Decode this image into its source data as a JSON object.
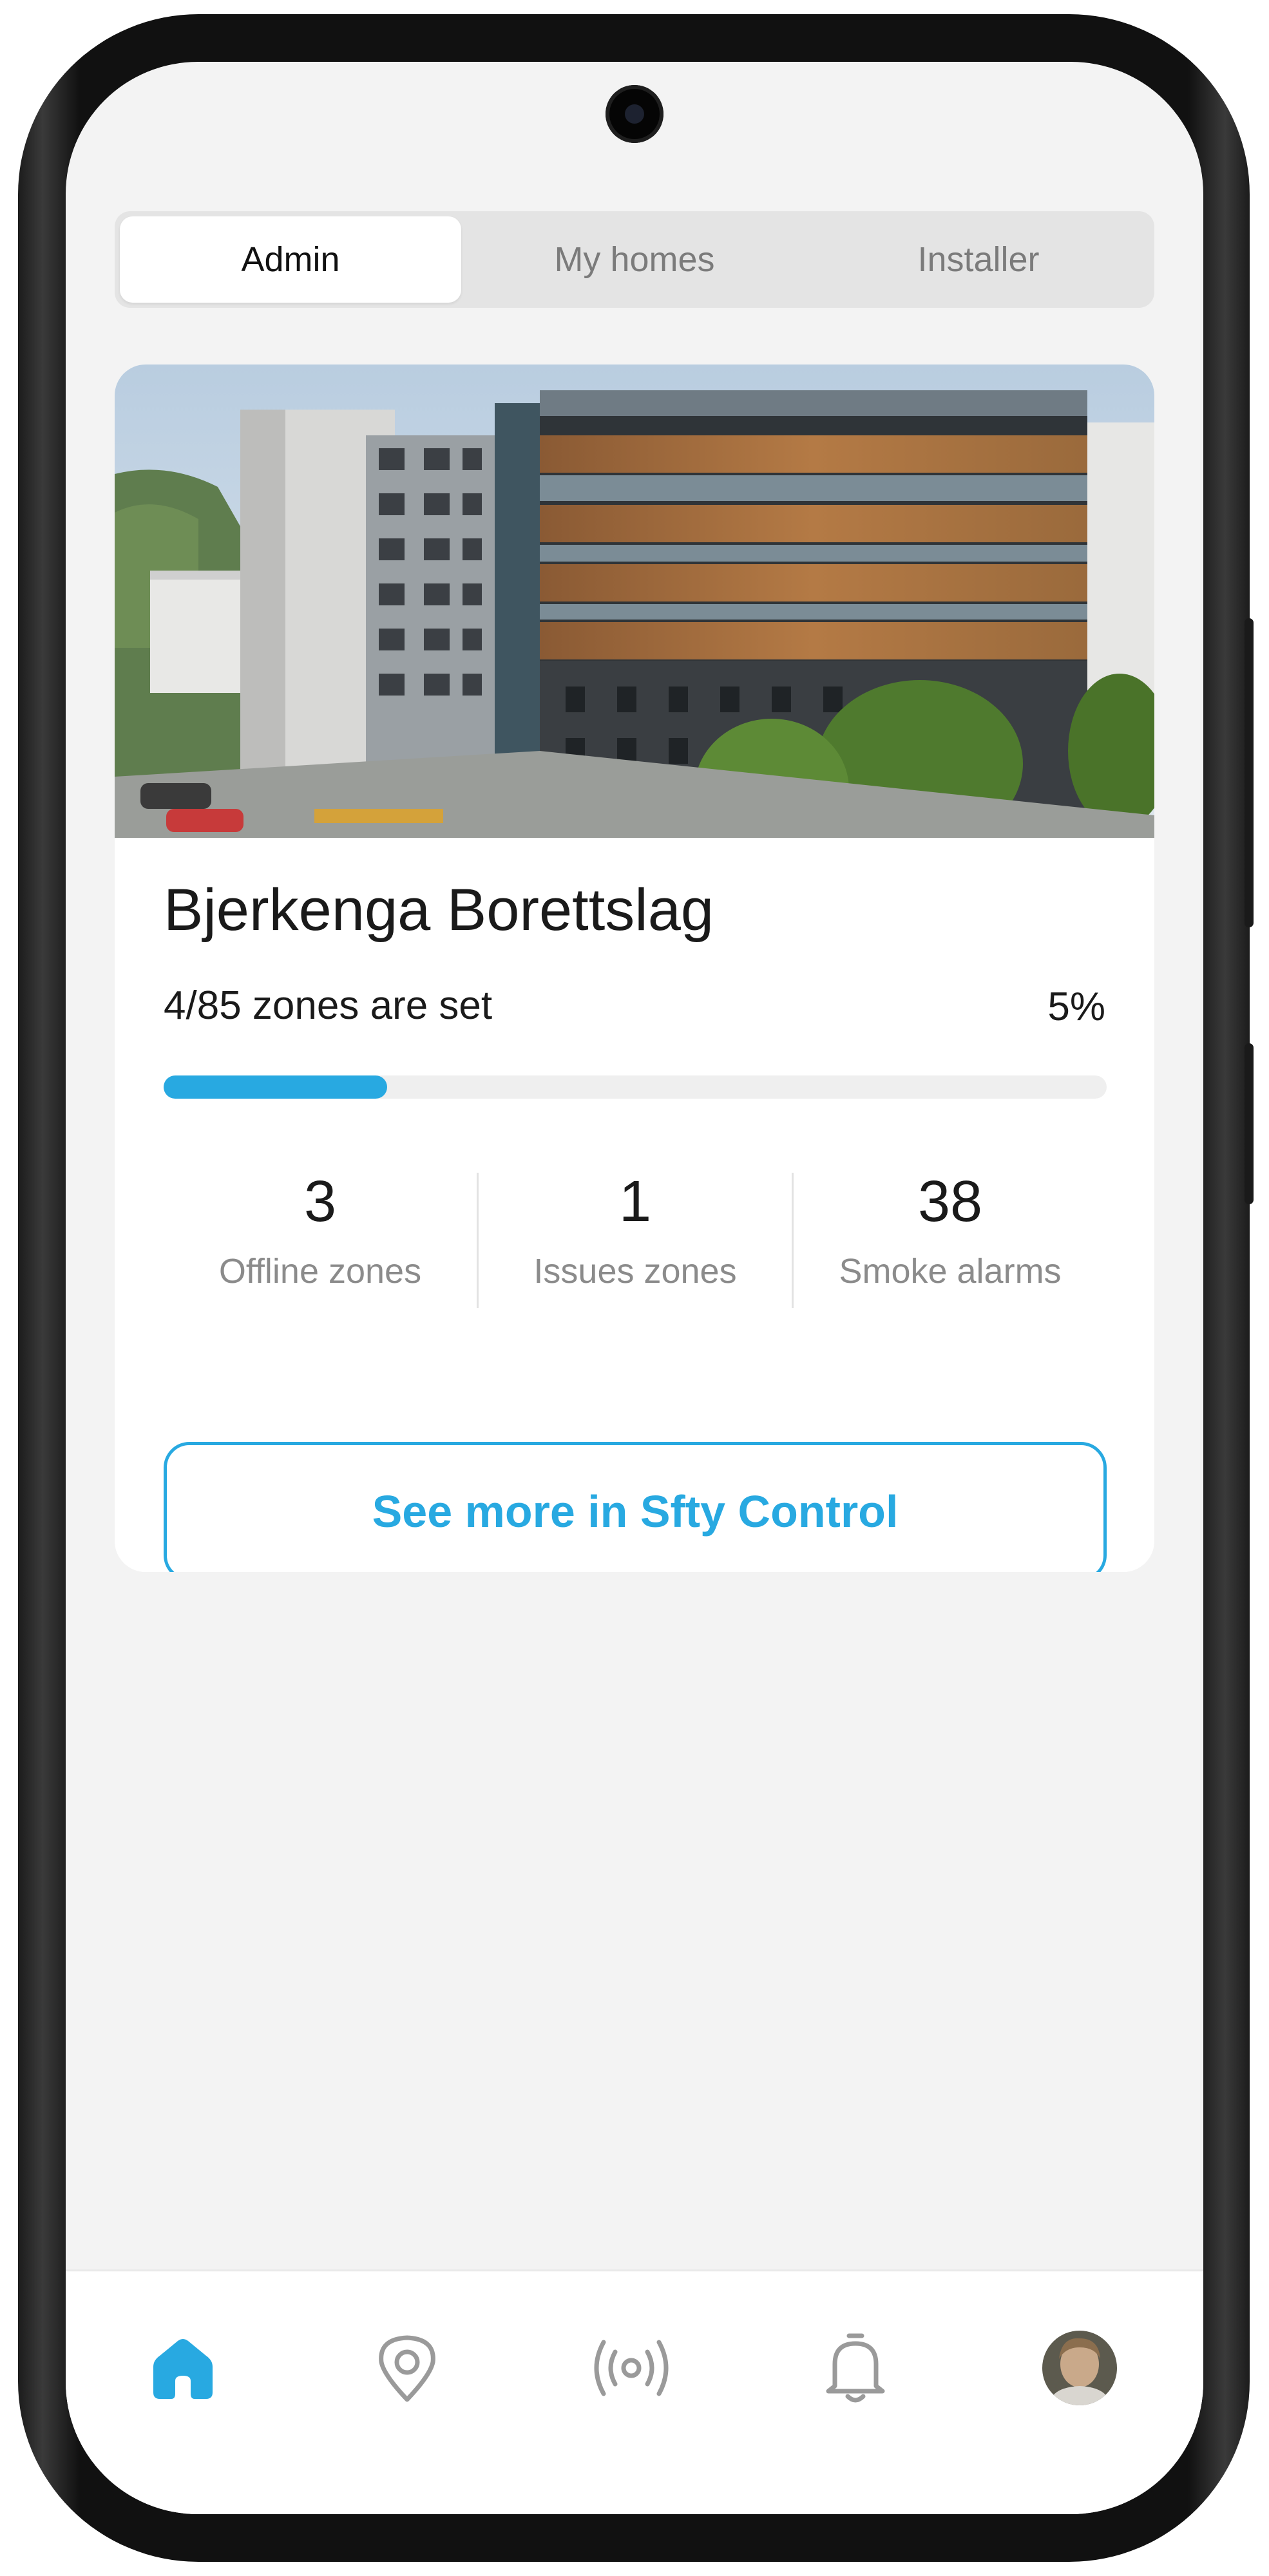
{
  "segmented": {
    "tabs": [
      {
        "label": "Admin",
        "active": true
      },
      {
        "label": "My homes",
        "active": false
      },
      {
        "label": "Installer",
        "active": false
      }
    ]
  },
  "building": {
    "name": "Bjerkenga Borettslag",
    "zones_text": "4/85 zones are set",
    "progress_percent_label": "5%",
    "progress_value": 0.05,
    "stats": [
      {
        "value": "3",
        "label": "Offline zones"
      },
      {
        "value": "1",
        "label": "Issues zones"
      },
      {
        "value": "38",
        "label": "Smoke alarms"
      }
    ],
    "cta_label": "See more in Sfty Control"
  },
  "tabbar": {
    "items": [
      {
        "icon": "home-icon",
        "active": true
      },
      {
        "icon": "location-pin-icon",
        "active": false
      },
      {
        "icon": "broadcast-signal-icon",
        "active": false
      },
      {
        "icon": "bell-icon",
        "active": false
      },
      {
        "icon": "user-avatar",
        "active": false
      }
    ]
  },
  "colors": {
    "accent": "#28a9e1",
    "background": "#f3f3f3",
    "text": "#1a1a1a",
    "muted": "#8b8b8b"
  }
}
